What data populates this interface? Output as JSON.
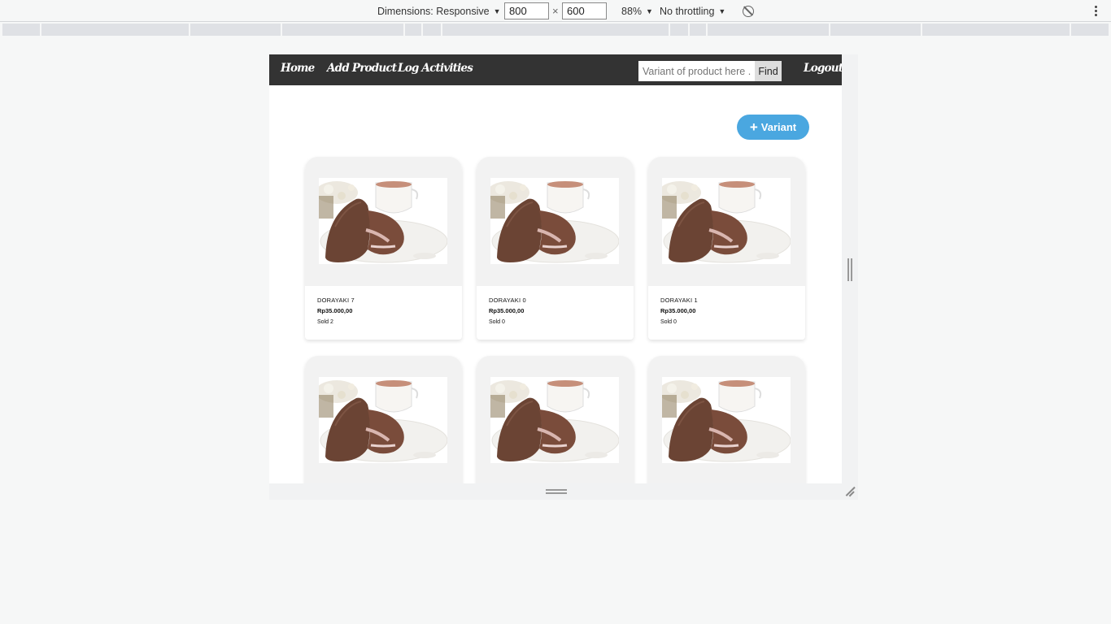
{
  "devtools": {
    "dimensions_label": "Dimensions: Responsive",
    "width_value": "800",
    "height_value": "600",
    "times_symbol": "×",
    "zoom": "88%",
    "throttling": "No throttling",
    "rotate_icon": "rotate-icon",
    "more_icon": "vertical-dots-icon"
  },
  "nav": {
    "home": "Home",
    "add_product": "Add Product",
    "log_activities": "Log Activities",
    "search_placeholder": "Variant of product here ...",
    "find": "Find",
    "logout": "Logout"
  },
  "variant_button": {
    "icon": "plus-icon",
    "plus": "+",
    "label": "Variant"
  },
  "colors": {
    "navbar": "#333333",
    "accent": "#4aa7e0"
  },
  "products": [
    {
      "name": "DORAYAKI 7",
      "price": "Rp35.000,00",
      "sold": "Sold 2"
    },
    {
      "name": "DORAYAKI 0",
      "price": "Rp35.000,00",
      "sold": "Sold 0"
    },
    {
      "name": "DORAYAKI 1",
      "price": "Rp35.000,00",
      "sold": "Sold 0"
    },
    {
      "name": "",
      "price": "",
      "sold": ""
    },
    {
      "name": "",
      "price": "",
      "sold": ""
    },
    {
      "name": "",
      "price": "",
      "sold": ""
    }
  ]
}
